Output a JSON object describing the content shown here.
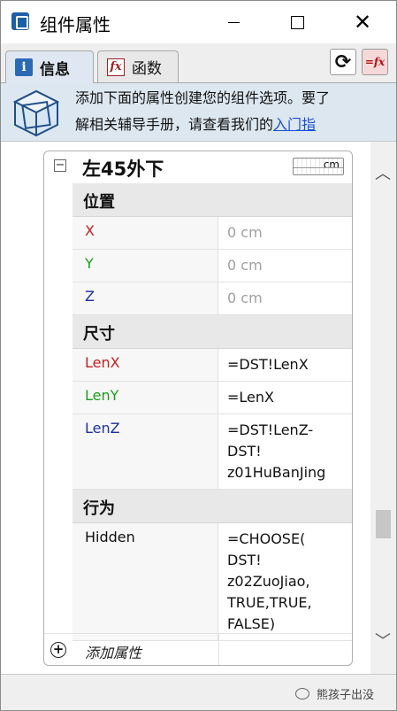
{
  "window": {
    "title": "组件属性"
  },
  "tabs": [
    {
      "label": "信息",
      "active": true
    },
    {
      "label": "函数",
      "active": false
    }
  ],
  "banner": {
    "line1": "添加下面的属性创建您的组件选项。要了",
    "line2_prefix": "解相关辅导手册，请查看我们的",
    "line2_link": "入门指"
  },
  "component": {
    "name": "左45外下",
    "unit": "cm",
    "sections": [
      {
        "title": "位置",
        "rows": [
          {
            "name": "X",
            "value": "0 cm"
          },
          {
            "name": "Y",
            "value": "0 cm"
          },
          {
            "name": "Z",
            "value": "0 cm"
          }
        ]
      },
      {
        "title": "尺寸",
        "rows": [
          {
            "name": "LenX",
            "value": "=DST!LenX"
          },
          {
            "name": "LenY",
            "value": "=LenX"
          },
          {
            "name": "LenZ",
            "value_lines": [
              "=DST!LenZ-",
              "DST!",
              "z01HuBanJing"
            ]
          }
        ]
      },
      {
        "title": "行为",
        "rows": [
          {
            "name": "Hidden",
            "value_lines": [
              "=CHOOSE(",
              "DST!",
              "z02ZuoJiao,",
              "TRUE,TRUE,",
              "FALSE)"
            ]
          }
        ]
      }
    ],
    "add_label": "添加属性"
  },
  "watermark": "熊孩子出没",
  "colors": {
    "x_axis": "#c42020",
    "y_axis": "#1aa01a",
    "z_axis": "#1c2fa0",
    "banner_bg": "#dde7f0",
    "link": "#1a4fd0"
  }
}
